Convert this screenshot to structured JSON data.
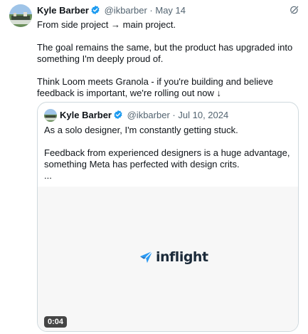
{
  "tweet": {
    "author_name": "Kyle Barber",
    "handle": "@ikbarber",
    "separator": "·",
    "date": "May 14",
    "icon": "grok-icon",
    "body": [
      "From side project → main project.",
      "The goal remains the same, but the product has upgraded into something I'm deeply proud of.",
      "Think Loom meets Granola - if you're building and believe feedback is important, we're rolling out now ↓"
    ]
  },
  "quote": {
    "author_name": "Kyle Barber",
    "handle": "@ikbarber",
    "separator": "·",
    "date": "Jul 10, 2024",
    "body": [
      "As a solo designer, I'm constantly getting stuck.",
      "Feedback from experienced designers is a huge advantage, something Meta has perfected with design crits.\n..."
    ],
    "video": {
      "logo_text": "inflight",
      "duration": "0:04"
    }
  },
  "colors": {
    "verified_blue": "#1d9bf0",
    "muted": "#536471",
    "border": "#cfd9de",
    "logo_blue": "#2b9af3"
  }
}
